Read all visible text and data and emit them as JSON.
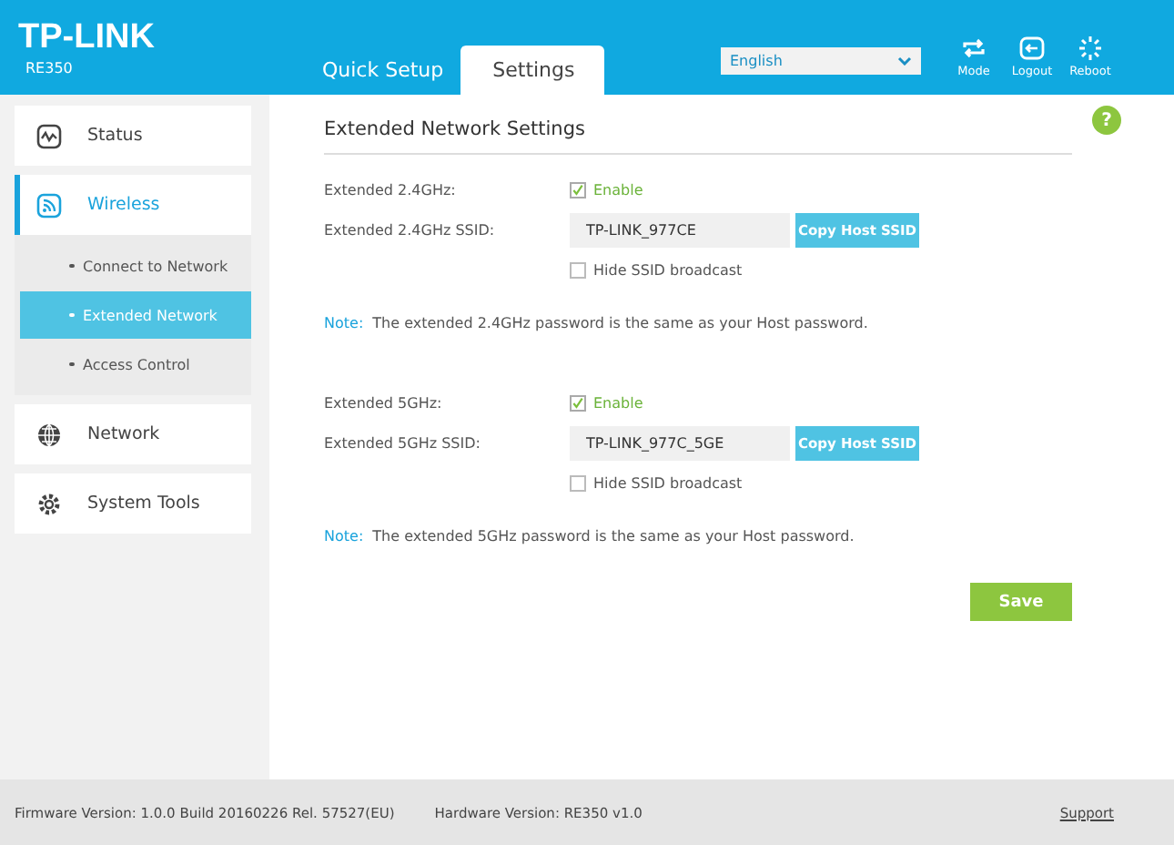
{
  "header": {
    "logo": "TP-LINK",
    "model": "RE350",
    "tabs": [
      {
        "label": "Quick Setup",
        "selected": false
      },
      {
        "label": "Settings",
        "selected": true
      }
    ],
    "language": "English",
    "actions": [
      {
        "label": "Mode",
        "kind": "mode"
      },
      {
        "label": "Logout",
        "kind": "logout"
      },
      {
        "label": "Reboot",
        "kind": "reboot"
      }
    ]
  },
  "sidebar": [
    {
      "label": "Status",
      "kind": "status",
      "selected": false
    },
    {
      "label": "Wireless",
      "kind": "wireless",
      "selected": true,
      "children": [
        {
          "label": "Connect to Network",
          "selected": false
        },
        {
          "label": "Extended Network",
          "selected": true
        },
        {
          "label": "Access Control",
          "selected": false
        }
      ]
    },
    {
      "label": "Network",
      "kind": "network",
      "selected": false
    },
    {
      "label": "System Tools",
      "kind": "tools",
      "selected": false
    }
  ],
  "content": {
    "title": "Extended Network Settings",
    "help": "?",
    "sections": [
      {
        "enable_label": "Extended 2.4GHz:",
        "enable_text": "Enable",
        "enabled": true,
        "ssid_label": "Extended 2.4GHz SSID:",
        "ssid": "TP-LINK_977CE",
        "copy_button": "Copy Host SSID",
        "hide_text": "Hide SSID broadcast",
        "hide_checked": false,
        "note_label": "Note:",
        "note_text": "The extended 2.4GHz password is the same as your Host password."
      },
      {
        "enable_label": "Extended 5GHz:",
        "enable_text": "Enable",
        "enabled": true,
        "ssid_label": "Extended 5GHz SSID:",
        "ssid": "TP-LINK_977C_5GE",
        "copy_button": "Copy Host SSID",
        "hide_text": "Hide SSID broadcast",
        "hide_checked": false,
        "note_label": "Note:",
        "note_text": "The extended 5GHz password is the same as your Host password."
      }
    ],
    "save": "Save"
  },
  "footer": {
    "firmware": "Firmware Version: 1.0.0 Build 20160226 Rel. 57527(EU)",
    "hardware": "Hardware Version: RE350 v1.0",
    "support": "Support"
  }
}
